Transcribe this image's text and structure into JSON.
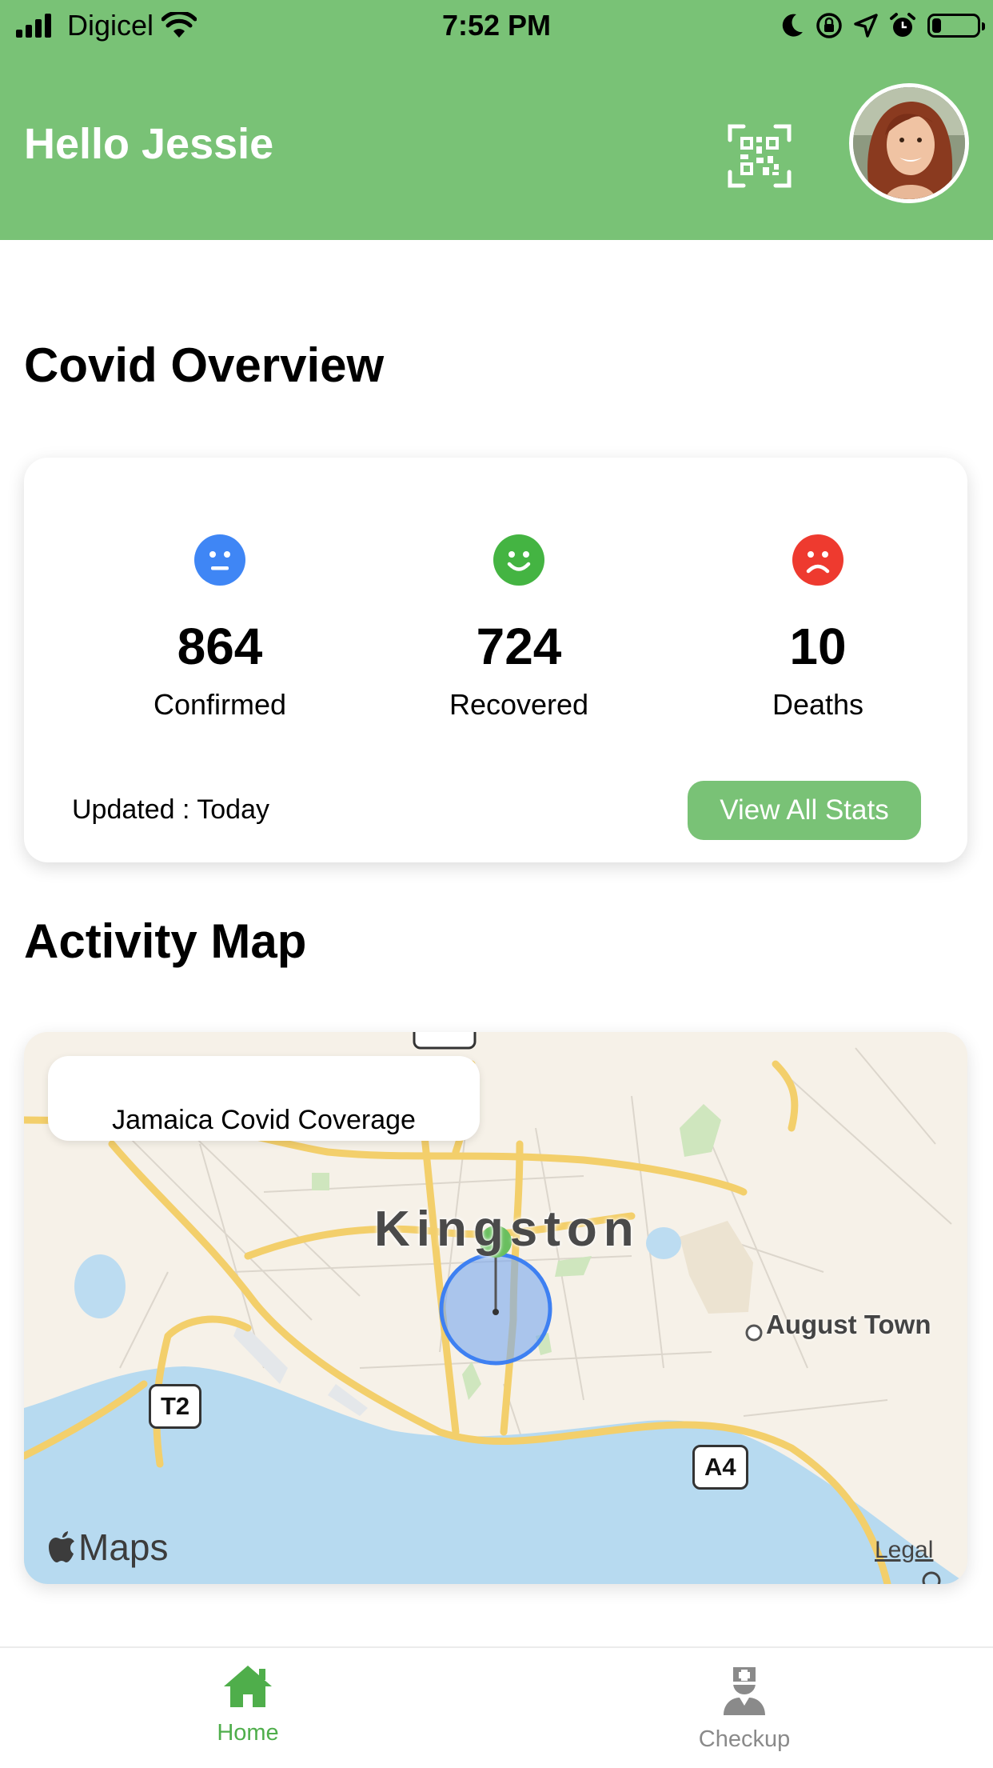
{
  "status_bar": {
    "carrier": "Digicel",
    "time": "7:52 PM",
    "battery_level": 0.2
  },
  "header": {
    "greeting": "Hello Jessie",
    "background_color": "#79c276"
  },
  "overview": {
    "title": "Covid Overview",
    "stats": [
      {
        "value": "864",
        "label": "Confirmed",
        "color": "#3f86f5",
        "icon": "neutral-face-icon"
      },
      {
        "value": "724",
        "label": "Recovered",
        "color": "#44b442",
        "icon": "smile-face-icon"
      },
      {
        "value": "10",
        "label": "Deaths",
        "color": "#ee3a2f",
        "icon": "sad-face-icon"
      }
    ],
    "updated": "Updated : Today",
    "view_all_label": "View All Stats"
  },
  "activity_map": {
    "title": "Activity Map",
    "coverage_label": "Jamaica Covid Coverage",
    "city": "Kingston",
    "town": "August Town",
    "road_badges": [
      "T2",
      "A4"
    ],
    "maps_brand": "Maps",
    "legal": "Legal"
  },
  "tab_bar": {
    "tabs": [
      {
        "label": "Home",
        "icon": "home-icon",
        "active": true
      },
      {
        "label": "Checkup",
        "icon": "doctor-icon",
        "active": false
      }
    ],
    "active_color": "#4fae4b",
    "inactive_color": "#8a8a8a"
  }
}
